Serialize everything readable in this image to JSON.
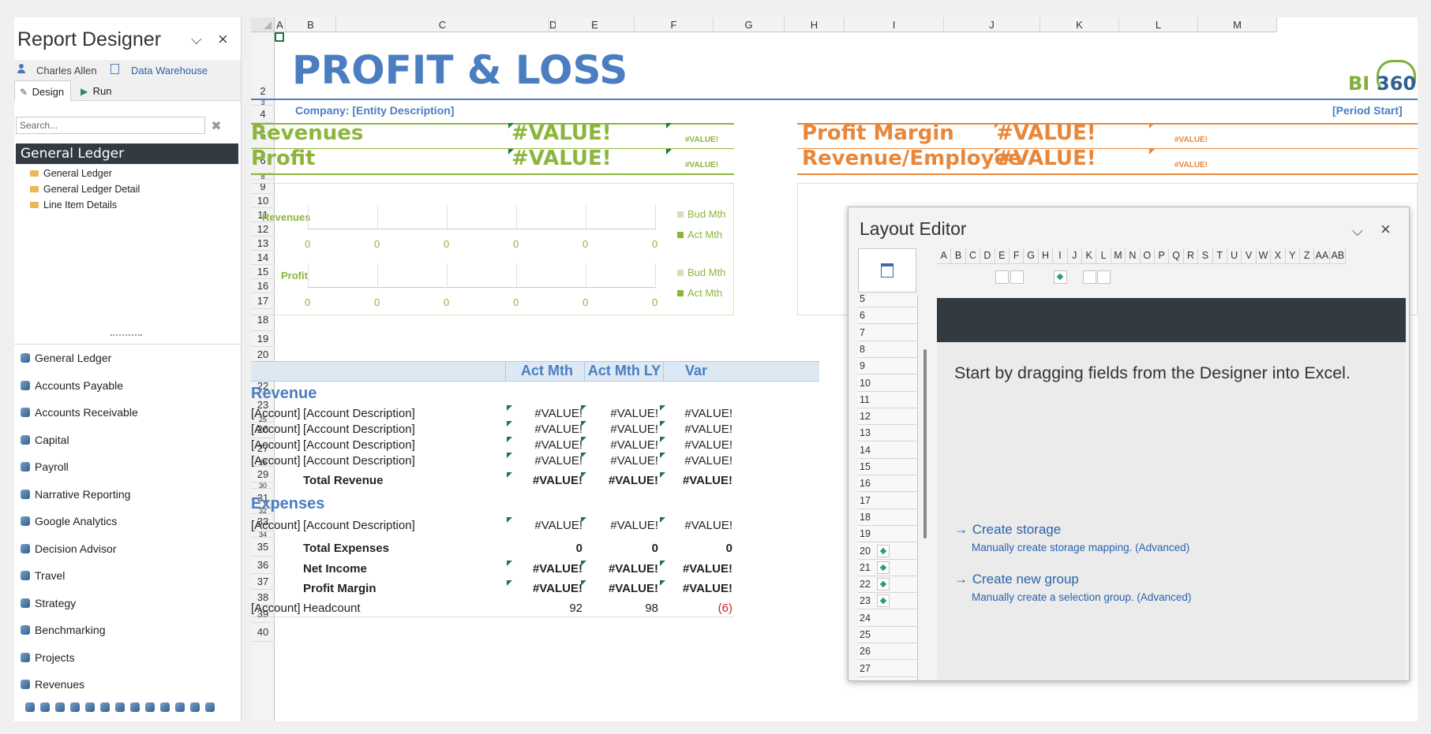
{
  "designer": {
    "title": "Report Designer",
    "user": "Charles Allen",
    "source": "Data Warehouse",
    "tabs": [
      "Design",
      "Run"
    ],
    "search_placeholder": "Search...",
    "tree_header": "General Ledger",
    "tree_items": [
      "General Ledger",
      "General Ledger Detail",
      "Line Item Details"
    ],
    "modules": [
      "General Ledger",
      "Accounts Payable",
      "Accounts Receivable",
      "Capital",
      "Payroll",
      "Narrative Reporting",
      "Google Analytics",
      "Decision Advisor",
      "Travel",
      "Strategy",
      "Benchmarking",
      "Projects",
      "Revenues"
    ]
  },
  "sheet": {
    "columns": [
      "A",
      "B",
      "C",
      "D",
      "E",
      "F",
      "G",
      "H",
      "I",
      "J",
      "K",
      "L",
      "M"
    ],
    "rows": [
      "2",
      "3",
      "4",
      "5",
      "6",
      "8",
      "9",
      "10",
      "11",
      "12",
      "13",
      "14",
      "15",
      "16",
      "17",
      "18",
      "19",
      "20",
      "21",
      "22",
      "23",
      "25",
      "26",
      "27",
      "28",
      "29",
      "30",
      "31",
      "32",
      "33",
      "34",
      "35",
      "36",
      "37",
      "38",
      "39",
      "40"
    ],
    "title": "PROFIT & LOSS",
    "logo_bi": "BI",
    "logo_num": "360",
    "company": "Company: [Entity Description]",
    "period": "[Period Start]",
    "kpis_left": [
      {
        "label": "Revenues",
        "value": "#VALUE!",
        "small": "#VALUE!"
      },
      {
        "label": "Profit",
        "value": "#VALUE!",
        "small": "#VALUE!"
      }
    ],
    "kpis_right": [
      {
        "label": "Profit Margin",
        "value": "#VALUE!",
        "small": "#VALUE!"
      },
      {
        "label": "Revenue/Employee",
        "value": "#VALUE!",
        "small": "#VALUE!"
      }
    ],
    "charts": [
      {
        "label": "Revenues",
        "zeros": [
          "0",
          "0",
          "0",
          "0",
          "0",
          "0"
        ],
        "legend": [
          "Bud Mth",
          "Act Mth"
        ]
      },
      {
        "label": "Profit",
        "zeros": [
          "0",
          "0",
          "0",
          "0",
          "0",
          "0"
        ],
        "legend": [
          "Bud Mth",
          "Act Mth"
        ]
      }
    ],
    "table_headers": [
      "Act Mth",
      "Act Mth LY",
      "Var"
    ],
    "revenue_title": "Revenue",
    "expenses_title": "Expenses",
    "account": "[Account]",
    "account_desc": "[Account Description]",
    "value_err": "#VALUE!",
    "total_revenue": "Total Revenue",
    "total_expenses": "Total Expenses",
    "total_expenses_vals": [
      "0",
      "0",
      "0"
    ],
    "net_income": "Net Income",
    "profit_margin": "Profit Margin",
    "headcount": "Headcount",
    "headcount_vals": [
      "92",
      "98",
      "(6)"
    ]
  },
  "layout_editor": {
    "title": "Layout Editor",
    "columns": [
      "A",
      "B",
      "C",
      "D",
      "E",
      "F",
      "G",
      "H",
      "I",
      "J",
      "K",
      "L",
      "M",
      "N",
      "O",
      "P",
      "Q",
      "R",
      "S",
      "T",
      "U",
      "V",
      "W",
      "X",
      "Y",
      "Z",
      "AA",
      "AB"
    ],
    "rows": [
      "5",
      "6",
      "7",
      "8",
      "9",
      "10",
      "11",
      "12",
      "13",
      "14",
      "15",
      "16",
      "17",
      "18",
      "19",
      "20",
      "21",
      "22",
      "23",
      "24",
      "25",
      "26",
      "27"
    ],
    "message": "Start by dragging fields from the Designer into Excel.",
    "create_storage": "Create storage",
    "create_storage_sub": "Manually create storage mapping. (Advanced)",
    "create_group": "Create new group",
    "create_group_sub": "Manually create a selection group. (Advanced)"
  },
  "colors": {
    "blue": "#4a7ec0",
    "green": "#8db53c",
    "orange": "#e8873a",
    "dark": "#333a42"
  }
}
